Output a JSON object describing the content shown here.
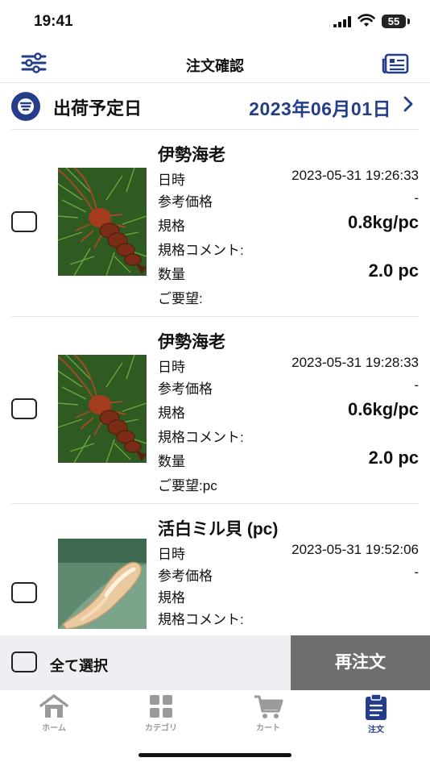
{
  "status": {
    "time": "19:41",
    "battery": "55"
  },
  "header": {
    "title": "注文確認",
    "left_icon": "filter-sliders-icon",
    "right_icon": "order-list-icon"
  },
  "shipping": {
    "label": "出荷予定日",
    "date": "2023年06月01日",
    "icon": "list-circle-icon"
  },
  "field_labels": {
    "datetime": "日時",
    "ref_price": "参考価格",
    "spec": "規格",
    "spec_comment": "規格コメント:",
    "quantity": "数量",
    "request": "ご要望:"
  },
  "items": [
    {
      "name": "伊勢海老",
      "datetime": "2023-05-31 19:26:33",
      "ref_price": "-",
      "spec": "0.8kg/pc",
      "spec_comment": "",
      "quantity": "2.0 pc",
      "request": ""
    },
    {
      "name": "伊勢海老",
      "datetime": "2023-05-31 19:28:33",
      "ref_price": "-",
      "spec": "0.6kg/pc",
      "spec_comment": "",
      "quantity": "2.0 pc",
      "request": "pc"
    },
    {
      "name": "活白ミル貝 (pc)",
      "datetime": "2023-05-31 19:52:06",
      "ref_price": "-",
      "spec": "",
      "spec_comment": ""
    }
  ],
  "bottom": {
    "select_all": "全て選択",
    "reorder": "再注文"
  },
  "tabs": [
    {
      "label": "ホーム",
      "icon": "home-icon"
    },
    {
      "label": "カテゴリ",
      "icon": "grid-icon"
    },
    {
      "label": "カート",
      "icon": "cart-icon"
    },
    {
      "label": "注文",
      "icon": "clipboard-icon",
      "active": true
    }
  ],
  "colors": {
    "accent": "#233d8a",
    "reorder_bg": "#6e6e6e",
    "inactive_tab": "#9a9a9a"
  }
}
